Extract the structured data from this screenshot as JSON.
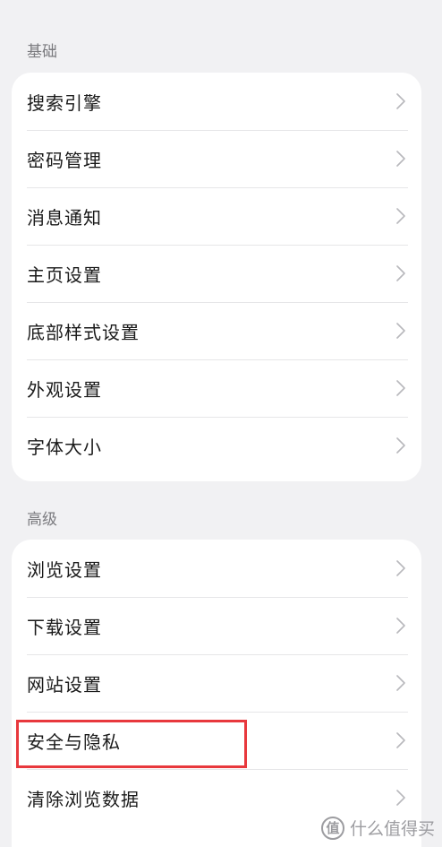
{
  "sections": [
    {
      "title": "基础",
      "items": [
        "搜索引擎",
        "密码管理",
        "消息通知",
        "主页设置",
        "底部样式设置",
        "外观设置",
        "字体大小"
      ]
    },
    {
      "title": "高级",
      "items": [
        "浏览设置",
        "下载设置",
        "网站设置",
        "安全与隐私",
        "清除浏览数据"
      ]
    }
  ],
  "watermark": {
    "logo": "值",
    "text": "什么值得买"
  },
  "colors": {
    "background": "#f1f1f3",
    "card": "#ffffff",
    "highlight": "#e8383d",
    "secondary_text": "#7b7b7f"
  },
  "icons": {
    "row_trailing": "chevron-right-icon"
  }
}
